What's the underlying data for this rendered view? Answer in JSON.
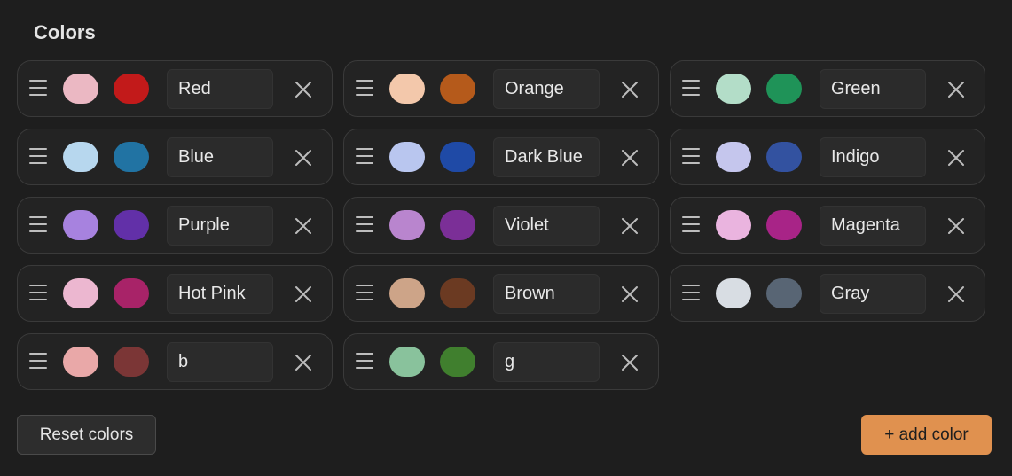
{
  "section": {
    "title": "Colors"
  },
  "colors": [
    {
      "name": "Red",
      "light": "#ebb8c3",
      "dark": "#c21a1a"
    },
    {
      "name": "Orange",
      "light": "#f3c8ab",
      "dark": "#b55a1b"
    },
    {
      "name": "Green",
      "light": "#b3ddc8",
      "dark": "#1f9358"
    },
    {
      "name": "Blue",
      "light": "#b7d7ee",
      "dark": "#2173a3"
    },
    {
      "name": "Dark Blue",
      "light": "#b9c6ef",
      "dark": "#1f4aa6"
    },
    {
      "name": "Indigo",
      "light": "#c5c6ed",
      "dark": "#3352a0"
    },
    {
      "name": "Purple",
      "light": "#a782df",
      "dark": "#6230a8"
    },
    {
      "name": "Violet",
      "light": "#b985ce",
      "dark": "#7b2f97"
    },
    {
      "name": "Magenta",
      "light": "#eab4df",
      "dark": "#a82487"
    },
    {
      "name": "Hot Pink",
      "light": "#ecb7d0",
      "dark": "#a82368"
    },
    {
      "name": "Brown",
      "light": "#cda488",
      "dark": "#6b3a22"
    },
    {
      "name": "Gray",
      "light": "#d8dde3",
      "dark": "#586574"
    },
    {
      "name": "b",
      "light": "#e9a8a8",
      "dark": "#7b3636"
    },
    {
      "name": "g",
      "light": "#89c29c",
      "dark": "#407f2e"
    }
  ],
  "actions": {
    "reset_label": "Reset colors",
    "add_label": "+ add color",
    "add_color": "#e0914f"
  },
  "icons": {
    "handle": "drag-handle-icon",
    "remove": "close-icon"
  }
}
